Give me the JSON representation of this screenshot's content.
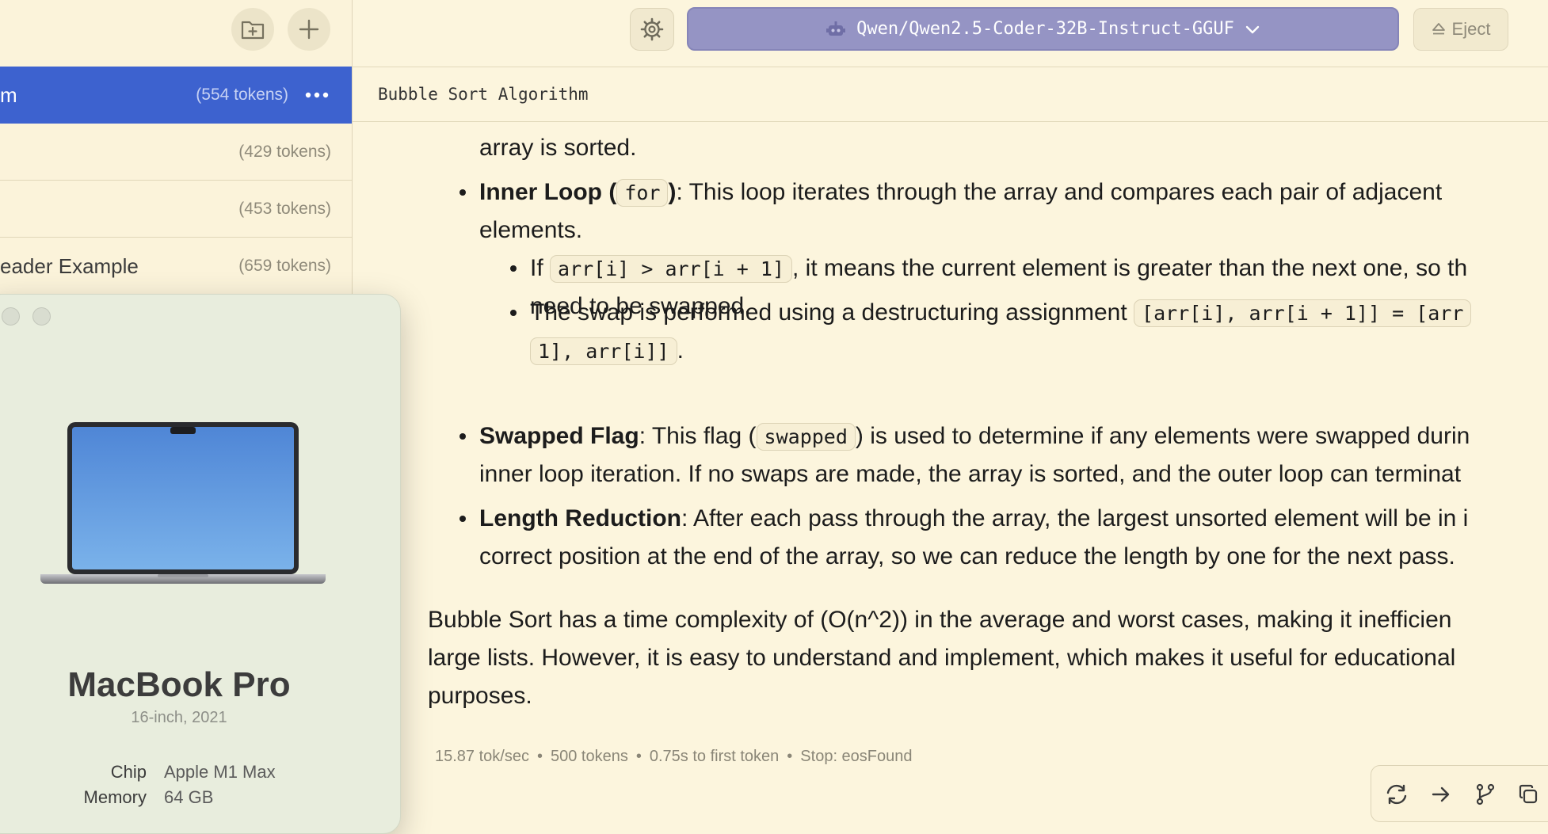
{
  "sidebar": {
    "chats": [
      {
        "name": "m",
        "tokens": "(554 tokens)",
        "active": true
      },
      {
        "name": "",
        "tokens": "(429 tokens)"
      },
      {
        "name": "",
        "tokens": "(453 tokens)"
      },
      {
        "name": "eader Example",
        "tokens": "(659 tokens)"
      }
    ]
  },
  "about": {
    "name": "MacBook Pro",
    "subtitle": "16-inch, 2021",
    "specs": [
      {
        "key": "Chip",
        "value": "Apple M1 Max"
      },
      {
        "key": "Memory",
        "value": "64 GB"
      }
    ]
  },
  "toolbar": {
    "model": "Qwen/Qwen2.5-Coder-32B-Instruct-GGUF",
    "eject": "Eject"
  },
  "chat": {
    "title": "Bubble Sort Algorithm",
    "lines": {
      "l0": "array is sorted.",
      "l1_bold": "Inner Loop (",
      "l1_code": "for",
      "l1_bold2": ")",
      "l1_rest": ": This loop iterates through the array and compares each pair of adjacent",
      "l2": "elements.",
      "l3_a": "If ",
      "l3_code": "arr[i] > arr[i + 1]",
      "l3_rest": ", it means the current element is greater than the next one, so th",
      "l4": "need to be swapped.",
      "l5_a": "The swap is performed using a destructuring assignment ",
      "l5_code": "[arr[i], arr[i + 1]] = [arr",
      "l6_code": "1], arr[i]]",
      "l6_rest": ".",
      "l7_bold": "Swapped Flag",
      "l7_a": ": This flag (",
      "l7_code": "swapped",
      "l7_rest": ") is used to determine if any elements were swapped durin",
      "l8": "inner loop iteration. If no swaps are made, the array is sorted, and the outer loop can terminat",
      "l9_bold": "Length Reduction",
      "l9_rest": ": After each pass through the array, the largest unsorted element will be in i",
      "l10": "correct position at the end of the array, so we can reduce the length by one for the next pass.",
      "p1": "Bubble Sort has a time complexity of (O(n^2)) in the average and worst cases, making it inefficien",
      "p2": "large lists. However, it is easy to understand and implement, which makes it useful for educational",
      "p3": "purposes."
    },
    "stats": {
      "speed": "15.87 tok/sec",
      "tokens": "500 tokens",
      "first_token": "0.75s to first token",
      "stop": "Stop: eosFound"
    }
  },
  "colors": {
    "accent": "#3d62cf",
    "model_button": "#9594c4",
    "background": "#fcf5dd"
  },
  "icons": [
    "new-folder-icon",
    "plus-icon",
    "more-dots-icon",
    "gear-icon",
    "robot-icon",
    "chevron-down-icon",
    "eject-icon",
    "regenerate-icon",
    "continue-arrow-icon",
    "branch-icon",
    "copy-icon"
  ]
}
